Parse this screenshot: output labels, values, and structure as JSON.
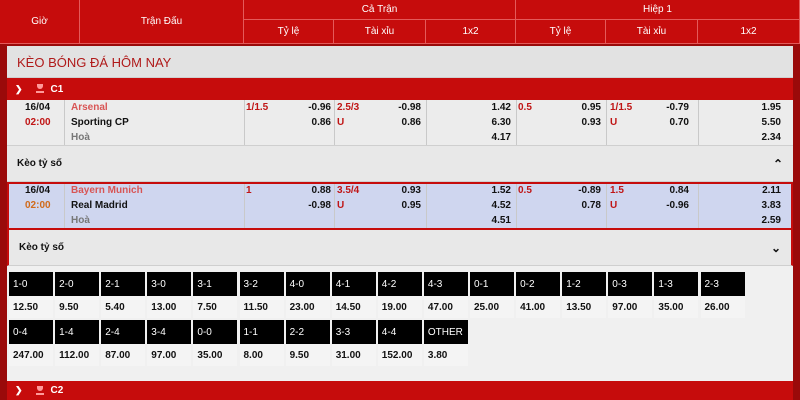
{
  "header": {
    "time": "Giờ",
    "match": "Trận Đấu",
    "full_match": "Cả Trận",
    "first_half": "Hiệp 1",
    "handicap": "Tỷ lệ",
    "over_under": "Tài xỉu",
    "one_x_two": "1x2",
    "handicap_h1": "Tỷ lệ",
    "over_under_h1": "Tài xỉu",
    "one_x_two_h1": "1x2"
  },
  "section_title": "KÈO BÓNG ĐÁ HÔM NAY",
  "league_1": "C1",
  "league_2": "C2",
  "correct_score_label": "Kèo tỷ số",
  "correct_score_label_2": "Kèo tỷ số",
  "matches": [
    {
      "date": "16/04",
      "time": "02:00",
      "home": "Arsenal",
      "away": "Sporting CP",
      "draw": "Hoà",
      "ft_hdp_line": "1/1.5",
      "ft_hdp_home": "-0.96",
      "ft_hdp_away": "0.86",
      "ft_ou_line": "2.5/3",
      "ft_ou_u": "U",
      "ft_ou_over": "-0.98",
      "ft_ou_under": "0.86",
      "ft_1": "1.42",
      "ft_2": "6.30",
      "ft_x": "4.17",
      "h1_hdp_line": "0.5",
      "h1_hdp_home": "0.95",
      "h1_hdp_away": "0.93",
      "h1_ou_line": "1/1.5",
      "h1_ou_u": "U",
      "h1_ou_over": "-0.79",
      "h1_ou_under": "0.70",
      "h1_1": "1.95",
      "h1_2": "5.50",
      "h1_x": "2.34"
    },
    {
      "date": "16/04",
      "time": "02:00",
      "home": "Bayern Munich",
      "away": "Real Madrid",
      "draw": "Hoà",
      "ft_hdp_line": "1",
      "ft_hdp_home": "0.88",
      "ft_hdp_away": "-0.98",
      "ft_ou_line": "3.5/4",
      "ft_ou_u": "U",
      "ft_ou_over": "0.93",
      "ft_ou_under": "0.95",
      "ft_1": "1.52",
      "ft_2": "4.52",
      "ft_x": "4.51",
      "h1_hdp_line": "0.5",
      "h1_hdp_home": "-0.89",
      "h1_hdp_away": "0.78",
      "h1_ou_line": "1.5",
      "h1_ou_u": "U",
      "h1_ou_over": "0.84",
      "h1_ou_under": "-0.96",
      "h1_1": "2.11",
      "h1_2": "3.83",
      "h1_x": "2.59"
    }
  ],
  "correct_scores": [
    {
      "score": "1-0",
      "odds": "12.50"
    },
    {
      "score": "2-0",
      "odds": "9.50"
    },
    {
      "score": "2-1",
      "odds": "5.40"
    },
    {
      "score": "3-0",
      "odds": "13.00"
    },
    {
      "score": "3-1",
      "odds": "7.50"
    },
    {
      "score": "3-2",
      "odds": "11.50"
    },
    {
      "score": "4-0",
      "odds": "23.00"
    },
    {
      "score": "4-1",
      "odds": "14.50"
    },
    {
      "score": "4-2",
      "odds": "19.00"
    },
    {
      "score": "4-3",
      "odds": "47.00"
    },
    {
      "score": "0-1",
      "odds": "25.00"
    },
    {
      "score": "0-2",
      "odds": "41.00"
    },
    {
      "score": "1-2",
      "odds": "13.50"
    },
    {
      "score": "0-3",
      "odds": "97.00"
    },
    {
      "score": "1-3",
      "odds": "35.00"
    },
    {
      "score": "2-3",
      "odds": "26.00"
    },
    {
      "score": "0-4",
      "odds": "247.00"
    },
    {
      "score": "1-4",
      "odds": "112.00"
    },
    {
      "score": "2-4",
      "odds": "87.00"
    },
    {
      "score": "3-4",
      "odds": "97.00"
    },
    {
      "score": "0-0",
      "odds": "35.00"
    },
    {
      "score": "1-1",
      "odds": "8.00"
    },
    {
      "score": "2-2",
      "odds": "9.50"
    },
    {
      "score": "3-3",
      "odds": "31.00"
    },
    {
      "score": "4-4",
      "odds": "152.00"
    },
    {
      "score": "OTHER",
      "odds": "3.80"
    }
  ],
  "icons": {
    "chevron_down": "chevron-down-icon",
    "chevron_up": "chevron-up-icon",
    "trophy": "trophy-icon"
  },
  "colors": {
    "brand_red": "#c60c0c",
    "highlight_row": "#cfd6ef",
    "time_orange": "#d06a1a"
  }
}
